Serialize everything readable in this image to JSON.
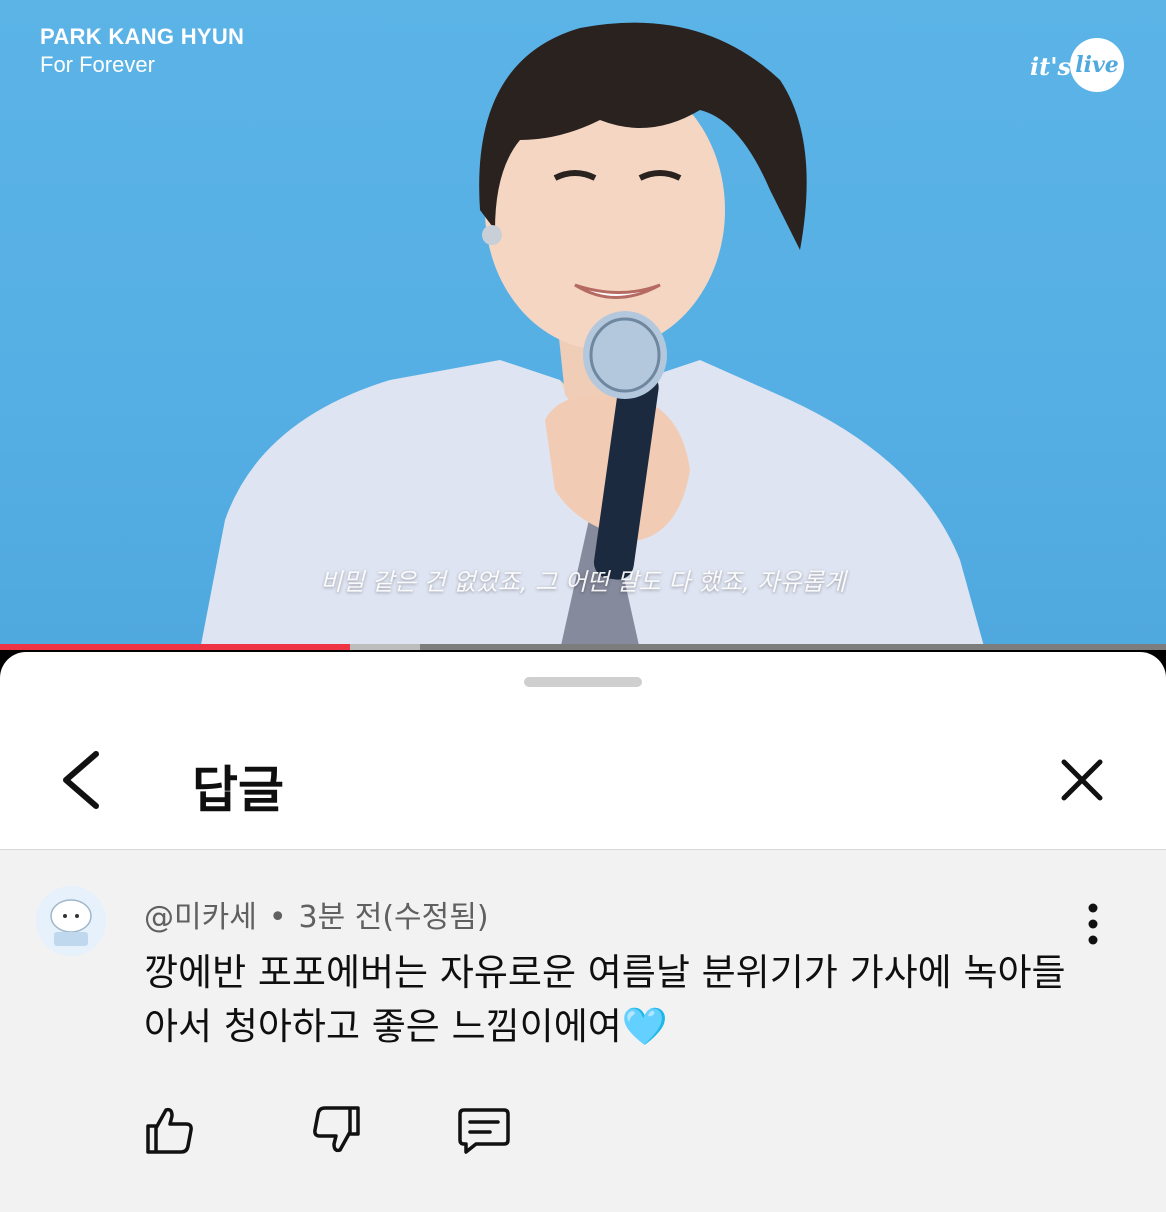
{
  "video": {
    "artist": "PARK KANG HYUN",
    "song": "For Forever",
    "brand": {
      "its": "it's",
      "live": "live"
    },
    "subtitle": "비밀 같은 건 없었죠, 그 어떤 말도 다 했죠, 자유롭게",
    "progress": {
      "played_fraction": 0.3,
      "buffered_fraction": 0.36,
      "played_color": "#ee3344"
    }
  },
  "sheet": {
    "title": "답글"
  },
  "comment": {
    "author": "@미카세",
    "separator": "•",
    "time": "3분 전(수정됨)",
    "text": "깡에반 포포에버는 자유로운 여름날 분위기가 가사에 녹아들아서 청아하고 좋은 느낌이에여",
    "emoji": "🩵"
  },
  "icons": {
    "back": "chevron-left-icon",
    "close": "close-icon",
    "more": "more-vertical-icon",
    "like": "thumbs-up-icon",
    "dislike": "thumbs-down-icon",
    "reply": "comment-icon"
  }
}
